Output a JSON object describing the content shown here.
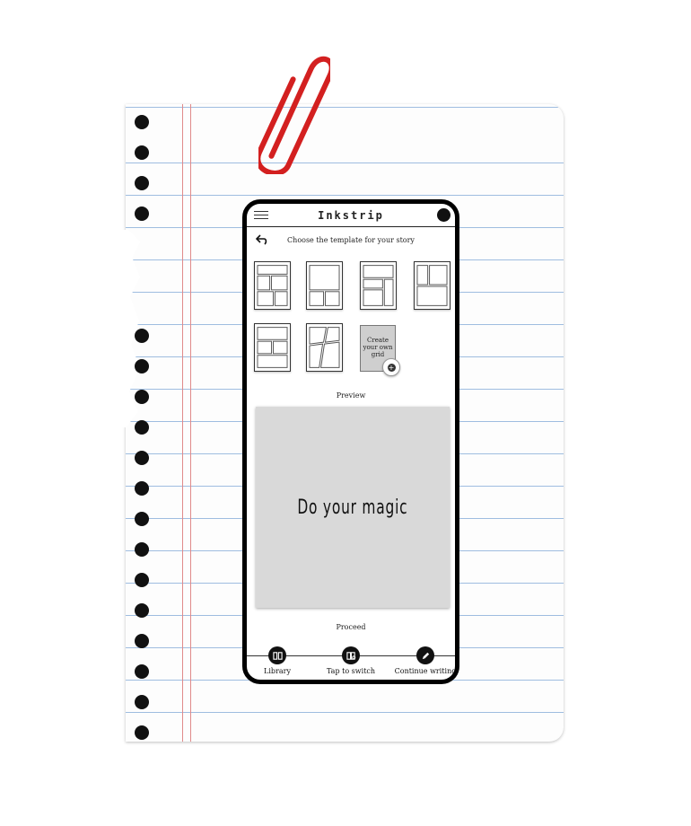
{
  "app": {
    "title": "Inkstrip",
    "subtitle": "Choose the template for your story",
    "preview_label": "Preview",
    "canvas_text": "Do your magic",
    "proceed_label": "Proceed"
  },
  "templates": {
    "create_own_label": "Create your own grid"
  },
  "nav": {
    "library": "Library",
    "switch": "Tap to switch",
    "continue": "Continue writing"
  },
  "colors": {
    "paper_lines": "#9fbde0",
    "margin_lines": "#e08a8a",
    "paperclip": "#d32020",
    "canvas": "#d9d9d9"
  }
}
